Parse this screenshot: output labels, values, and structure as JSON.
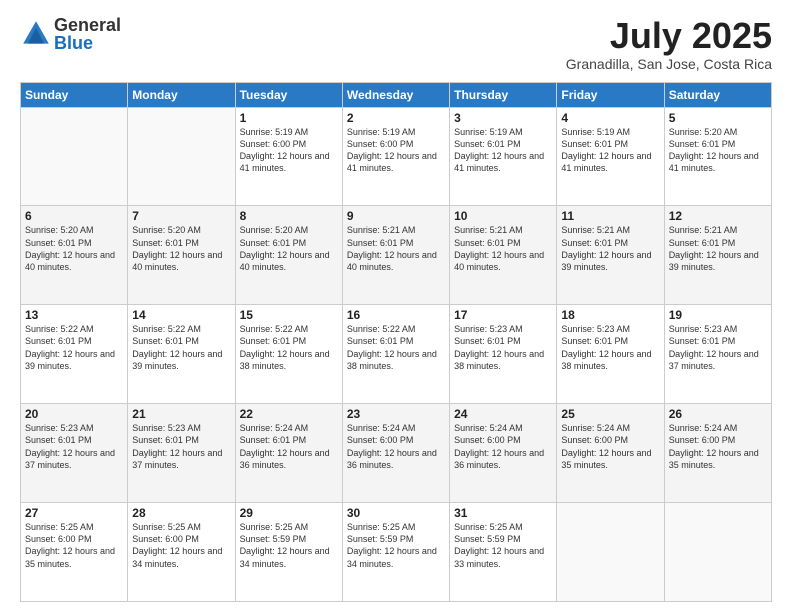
{
  "logo": {
    "general": "General",
    "blue": "Blue"
  },
  "header": {
    "month": "July 2025",
    "location": "Granadilla, San Jose, Costa Rica"
  },
  "days_of_week": [
    "Sunday",
    "Monday",
    "Tuesday",
    "Wednesday",
    "Thursday",
    "Friday",
    "Saturday"
  ],
  "weeks": [
    [
      {
        "day": "",
        "info": ""
      },
      {
        "day": "",
        "info": ""
      },
      {
        "day": "1",
        "info": "Sunrise: 5:19 AM\nSunset: 6:00 PM\nDaylight: 12 hours and 41 minutes."
      },
      {
        "day": "2",
        "info": "Sunrise: 5:19 AM\nSunset: 6:00 PM\nDaylight: 12 hours and 41 minutes."
      },
      {
        "day": "3",
        "info": "Sunrise: 5:19 AM\nSunset: 6:01 PM\nDaylight: 12 hours and 41 minutes."
      },
      {
        "day": "4",
        "info": "Sunrise: 5:19 AM\nSunset: 6:01 PM\nDaylight: 12 hours and 41 minutes."
      },
      {
        "day": "5",
        "info": "Sunrise: 5:20 AM\nSunset: 6:01 PM\nDaylight: 12 hours and 41 minutes."
      }
    ],
    [
      {
        "day": "6",
        "info": "Sunrise: 5:20 AM\nSunset: 6:01 PM\nDaylight: 12 hours and 40 minutes."
      },
      {
        "day": "7",
        "info": "Sunrise: 5:20 AM\nSunset: 6:01 PM\nDaylight: 12 hours and 40 minutes."
      },
      {
        "day": "8",
        "info": "Sunrise: 5:20 AM\nSunset: 6:01 PM\nDaylight: 12 hours and 40 minutes."
      },
      {
        "day": "9",
        "info": "Sunrise: 5:21 AM\nSunset: 6:01 PM\nDaylight: 12 hours and 40 minutes."
      },
      {
        "day": "10",
        "info": "Sunrise: 5:21 AM\nSunset: 6:01 PM\nDaylight: 12 hours and 40 minutes."
      },
      {
        "day": "11",
        "info": "Sunrise: 5:21 AM\nSunset: 6:01 PM\nDaylight: 12 hours and 39 minutes."
      },
      {
        "day": "12",
        "info": "Sunrise: 5:21 AM\nSunset: 6:01 PM\nDaylight: 12 hours and 39 minutes."
      }
    ],
    [
      {
        "day": "13",
        "info": "Sunrise: 5:22 AM\nSunset: 6:01 PM\nDaylight: 12 hours and 39 minutes."
      },
      {
        "day": "14",
        "info": "Sunrise: 5:22 AM\nSunset: 6:01 PM\nDaylight: 12 hours and 39 minutes."
      },
      {
        "day": "15",
        "info": "Sunrise: 5:22 AM\nSunset: 6:01 PM\nDaylight: 12 hours and 38 minutes."
      },
      {
        "day": "16",
        "info": "Sunrise: 5:22 AM\nSunset: 6:01 PM\nDaylight: 12 hours and 38 minutes."
      },
      {
        "day": "17",
        "info": "Sunrise: 5:23 AM\nSunset: 6:01 PM\nDaylight: 12 hours and 38 minutes."
      },
      {
        "day": "18",
        "info": "Sunrise: 5:23 AM\nSunset: 6:01 PM\nDaylight: 12 hours and 38 minutes."
      },
      {
        "day": "19",
        "info": "Sunrise: 5:23 AM\nSunset: 6:01 PM\nDaylight: 12 hours and 37 minutes."
      }
    ],
    [
      {
        "day": "20",
        "info": "Sunrise: 5:23 AM\nSunset: 6:01 PM\nDaylight: 12 hours and 37 minutes."
      },
      {
        "day": "21",
        "info": "Sunrise: 5:23 AM\nSunset: 6:01 PM\nDaylight: 12 hours and 37 minutes."
      },
      {
        "day": "22",
        "info": "Sunrise: 5:24 AM\nSunset: 6:01 PM\nDaylight: 12 hours and 36 minutes."
      },
      {
        "day": "23",
        "info": "Sunrise: 5:24 AM\nSunset: 6:00 PM\nDaylight: 12 hours and 36 minutes."
      },
      {
        "day": "24",
        "info": "Sunrise: 5:24 AM\nSunset: 6:00 PM\nDaylight: 12 hours and 36 minutes."
      },
      {
        "day": "25",
        "info": "Sunrise: 5:24 AM\nSunset: 6:00 PM\nDaylight: 12 hours and 35 minutes."
      },
      {
        "day": "26",
        "info": "Sunrise: 5:24 AM\nSunset: 6:00 PM\nDaylight: 12 hours and 35 minutes."
      }
    ],
    [
      {
        "day": "27",
        "info": "Sunrise: 5:25 AM\nSunset: 6:00 PM\nDaylight: 12 hours and 35 minutes."
      },
      {
        "day": "28",
        "info": "Sunrise: 5:25 AM\nSunset: 6:00 PM\nDaylight: 12 hours and 34 minutes."
      },
      {
        "day": "29",
        "info": "Sunrise: 5:25 AM\nSunset: 5:59 PM\nDaylight: 12 hours and 34 minutes."
      },
      {
        "day": "30",
        "info": "Sunrise: 5:25 AM\nSunset: 5:59 PM\nDaylight: 12 hours and 34 minutes."
      },
      {
        "day": "31",
        "info": "Sunrise: 5:25 AM\nSunset: 5:59 PM\nDaylight: 12 hours and 33 minutes."
      },
      {
        "day": "",
        "info": ""
      },
      {
        "day": "",
        "info": ""
      }
    ]
  ]
}
